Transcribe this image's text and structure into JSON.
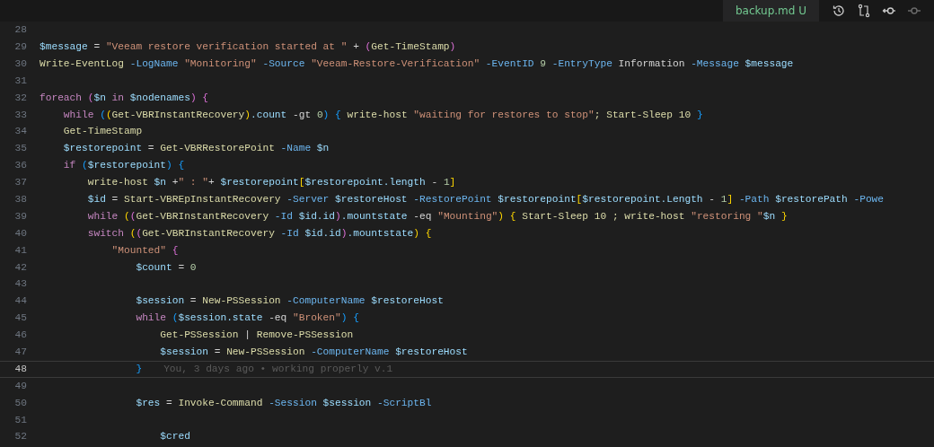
{
  "tab": {
    "label": "backup.md",
    "badge": "U"
  },
  "toolbar": [
    {
      "kind": "history",
      "disabled": false
    },
    {
      "kind": "compare",
      "disabled": false
    },
    {
      "kind": "back",
      "disabled": false
    },
    {
      "kind": "forward",
      "disabled": true
    }
  ],
  "lines": [
    {
      "number": "28",
      "current": false
    },
    {
      "number": "29",
      "current": false,
      "tokens": [
        {
          "text": "$message",
          "kind": "variable"
        },
        {
          "text": " = ",
          "kind": "plain"
        },
        {
          "text": "\"Veeam restore verification started at \"",
          "kind": "string"
        },
        {
          "text": " + ",
          "kind": "plain"
        },
        {
          "text": "(",
          "kind": "bracket2"
        },
        {
          "text": "Get-TimeStamp",
          "kind": "command"
        },
        {
          "text": ")",
          "kind": "bracket2"
        }
      ]
    },
    {
      "number": "30",
      "current": false,
      "tokens": [
        {
          "text": "Write-EventLog",
          "kind": "command"
        },
        {
          "text": " -LogName ",
          "kind": "parameter"
        },
        {
          "text": "\"Monitoring\"",
          "kind": "string"
        },
        {
          "text": " -Source ",
          "kind": "parameter"
        },
        {
          "text": "\"Veeam-Restore-Verification\"",
          "kind": "string"
        },
        {
          "text": " -EventID ",
          "kind": "parameter"
        },
        {
          "text": "9",
          "kind": "number"
        },
        {
          "text": " -EntryType ",
          "kind": "parameter"
        },
        {
          "text": "Information",
          "kind": "plain"
        },
        {
          "text": " -Message ",
          "kind": "parameter"
        },
        {
          "text": "$message",
          "kind": "variable"
        }
      ]
    },
    {
      "number": "31",
      "current": false
    },
    {
      "number": "32",
      "current": false,
      "tokens": [
        {
          "text": "foreach",
          "kind": "keyword"
        },
        {
          "text": " (",
          "kind": "bracket2"
        },
        {
          "text": "$n",
          "kind": "variable"
        },
        {
          "text": " in ",
          "kind": "keyword"
        },
        {
          "text": "$nodenames",
          "kind": "variable"
        },
        {
          "text": ") {",
          "kind": "bracket2"
        }
      ]
    },
    {
      "number": "33",
      "current": false,
      "tokens": [
        {
          "text": "    while",
          "kind": "keyword"
        },
        {
          "text": " (",
          "kind": "bracket3"
        },
        {
          "text": "(",
          "kind": "bracket1"
        },
        {
          "text": "Get-VBRInstantRecovery",
          "kind": "command"
        },
        {
          "text": ")",
          "kind": "bracket1"
        },
        {
          "text": ".count",
          "kind": "variable"
        },
        {
          "text": " -gt ",
          "kind": "plain"
        },
        {
          "text": "0",
          "kind": "number"
        },
        {
          "text": ") {",
          "kind": "bracket3"
        },
        {
          "text": " write-host ",
          "kind": "command"
        },
        {
          "text": "\"waiting for restores to stop\"",
          "kind": "string"
        },
        {
          "text": "; Start-Sleep 10 ",
          "kind": "command"
        },
        {
          "text": "}",
          "kind": "bracket3"
        }
      ]
    },
    {
      "number": "34",
      "current": false,
      "tokens": [
        {
          "text": "    Get-TimeStamp",
          "kind": "command"
        }
      ]
    },
    {
      "number": "35",
      "current": false,
      "tokens": [
        {
          "text": "    $restorepoint",
          "kind": "variable"
        },
        {
          "text": " = ",
          "kind": "plain"
        },
        {
          "text": "Get-VBRRestorePoint",
          "kind": "command"
        },
        {
          "text": " -Name ",
          "kind": "parameter"
        },
        {
          "text": "$n",
          "kind": "variable"
        }
      ]
    },
    {
      "number": "36",
      "current": false,
      "tokens": [
        {
          "text": "    if",
          "kind": "keyword"
        },
        {
          "text": " (",
          "kind": "bracket3"
        },
        {
          "text": "$restorepoint",
          "kind": "variable"
        },
        {
          "text": ") {",
          "kind": "bracket3"
        }
      ]
    },
    {
      "number": "37",
      "current": false,
      "tokens": [
        {
          "text": "        write-host ",
          "kind": "command"
        },
        {
          "text": "$n",
          "kind": "variable"
        },
        {
          "text": " +",
          "kind": "plain"
        },
        {
          "text": "\" : \"",
          "kind": "string"
        },
        {
          "text": "+ ",
          "kind": "plain"
        },
        {
          "text": "$restorepoint",
          "kind": "variable"
        },
        {
          "text": "[",
          "kind": "bracket1"
        },
        {
          "text": "$restorepoint.length",
          "kind": "variable"
        },
        {
          "text": " - ",
          "kind": "plain"
        },
        {
          "text": "1",
          "kind": "number"
        },
        {
          "text": "]",
          "kind": "bracket1"
        }
      ]
    },
    {
      "number": "38",
      "current": false,
      "tokens": [
        {
          "text": "        $id",
          "kind": "variable"
        },
        {
          "text": " = ",
          "kind": "plain"
        },
        {
          "text": "Start-VBREpInstantRecovery",
          "kind": "command"
        },
        {
          "text": " -Server ",
          "kind": "parameter"
        },
        {
          "text": "$restoreHost",
          "kind": "variable"
        },
        {
          "text": " -RestorePoint ",
          "kind": "parameter"
        },
        {
          "text": "$restorepoint",
          "kind": "variable"
        },
        {
          "text": "[",
          "kind": "bracket1"
        },
        {
          "text": "$restorepoint.Length",
          "kind": "variable"
        },
        {
          "text": " - ",
          "kind": "plain"
        },
        {
          "text": "1",
          "kind": "number"
        },
        {
          "text": "]",
          "kind": "bracket1"
        },
        {
          "text": " -Path ",
          "kind": "parameter"
        },
        {
          "text": "$restorePath",
          "kind": "variable"
        },
        {
          "text": " -Powe",
          "kind": "parameter"
        }
      ]
    },
    {
      "number": "39",
      "current": false,
      "tokens": [
        {
          "text": "        while",
          "kind": "keyword"
        },
        {
          "text": " (",
          "kind": "bracket1"
        },
        {
          "text": "(",
          "kind": "bracket2"
        },
        {
          "text": "Get-VBRInstantRecovery",
          "kind": "command"
        },
        {
          "text": " -Id ",
          "kind": "parameter"
        },
        {
          "text": "$id.id",
          "kind": "variable"
        },
        {
          "text": ")",
          "kind": "bracket2"
        },
        {
          "text": ".mountstate",
          "kind": "variable"
        },
        {
          "text": " -eq ",
          "kind": "plain"
        },
        {
          "text": "\"Mounting\"",
          "kind": "string"
        },
        {
          "text": ") {",
          "kind": "bracket1"
        },
        {
          "text": " Start-Sleep 10 ; write-host ",
          "kind": "command"
        },
        {
          "text": "\"restoring \"",
          "kind": "string"
        },
        {
          "text": "$n",
          "kind": "variable"
        },
        {
          "text": " }",
          "kind": "bracket1"
        }
      ]
    },
    {
      "number": "40",
      "current": false,
      "tokens": [
        {
          "text": "        switch",
          "kind": "keyword"
        },
        {
          "text": " (",
          "kind": "bracket1"
        },
        {
          "text": "(",
          "kind": "bracket2"
        },
        {
          "text": "Get-VBRInstantRecovery",
          "kind": "command"
        },
        {
          "text": " -Id ",
          "kind": "parameter"
        },
        {
          "text": "$id.id",
          "kind": "variable"
        },
        {
          "text": ")",
          "kind": "bracket2"
        },
        {
          "text": ".mountstate",
          "kind": "variable"
        },
        {
          "text": ") {",
          "kind": "bracket1"
        }
      ]
    },
    {
      "number": "41",
      "current": false,
      "tokens": [
        {
          "text": "            \"Mounted\"",
          "kind": "string"
        },
        {
          "text": " {",
          "kind": "bracket2"
        }
      ]
    },
    {
      "number": "42",
      "current": false,
      "tokens": [
        {
          "text": "                $count",
          "kind": "variable"
        },
        {
          "text": " = ",
          "kind": "plain"
        },
        {
          "text": "0",
          "kind": "number"
        }
      ]
    },
    {
      "number": "43",
      "current": false
    },
    {
      "number": "44",
      "current": false,
      "tokens": [
        {
          "text": "                $session",
          "kind": "variable"
        },
        {
          "text": " = ",
          "kind": "plain"
        },
        {
          "text": "New-PSSession",
          "kind": "command"
        },
        {
          "text": " -ComputerName ",
          "kind": "parameter"
        },
        {
          "text": "$restoreHost",
          "kind": "variable"
        }
      ]
    },
    {
      "number": "45",
      "current": false,
      "tokens": [
        {
          "text": "                while",
          "kind": "keyword"
        },
        {
          "text": " (",
          "kind": "bracket3"
        },
        {
          "text": "$session.state",
          "kind": "variable"
        },
        {
          "text": " -eq ",
          "kind": "plain"
        },
        {
          "text": "\"Broken\"",
          "kind": "string"
        },
        {
          "text": ") {",
          "kind": "bracket3"
        }
      ]
    },
    {
      "number": "46",
      "current": false,
      "tokens": [
        {
          "text": "                    Get-PSSession",
          "kind": "command"
        },
        {
          "text": " | ",
          "kind": "plain"
        },
        {
          "text": "Remove-PSSession",
          "kind": "command"
        }
      ]
    },
    {
      "number": "47",
      "current": false,
      "tokens": [
        {
          "text": "                    $session",
          "kind": "variable"
        },
        {
          "text": " = ",
          "kind": "plain"
        },
        {
          "text": "New-PSSession",
          "kind": "command"
        },
        {
          "text": " -ComputerName ",
          "kind": "parameter"
        },
        {
          "text": "$restoreHost",
          "kind": "variable"
        }
      ]
    },
    {
      "number": "48",
      "current": true,
      "tokens": [
        {
          "text": "                }",
          "kind": "bracket3"
        }
      ],
      "blame": "You, 3 days ago • working properly v.1"
    },
    {
      "number": "49",
      "current": false
    },
    {
      "number": "50",
      "current": false,
      "tokens": [
        {
          "text": "                $res",
          "kind": "variable"
        },
        {
          "text": " = ",
          "kind": "plain"
        },
        {
          "text": "Invoke-Command",
          "kind": "command"
        },
        {
          "text": " -Session ",
          "kind": "parameter"
        },
        {
          "text": "$session",
          "kind": "variable"
        },
        {
          "text": " -ScriptBl",
          "kind": "parameter"
        }
      ]
    },
    {
      "number": "51",
      "current": false
    },
    {
      "number": "52",
      "current": false,
      "tokens": [
        {
          "text": "                    $cred",
          "kind": "variable"
        }
      ]
    }
  ]
}
